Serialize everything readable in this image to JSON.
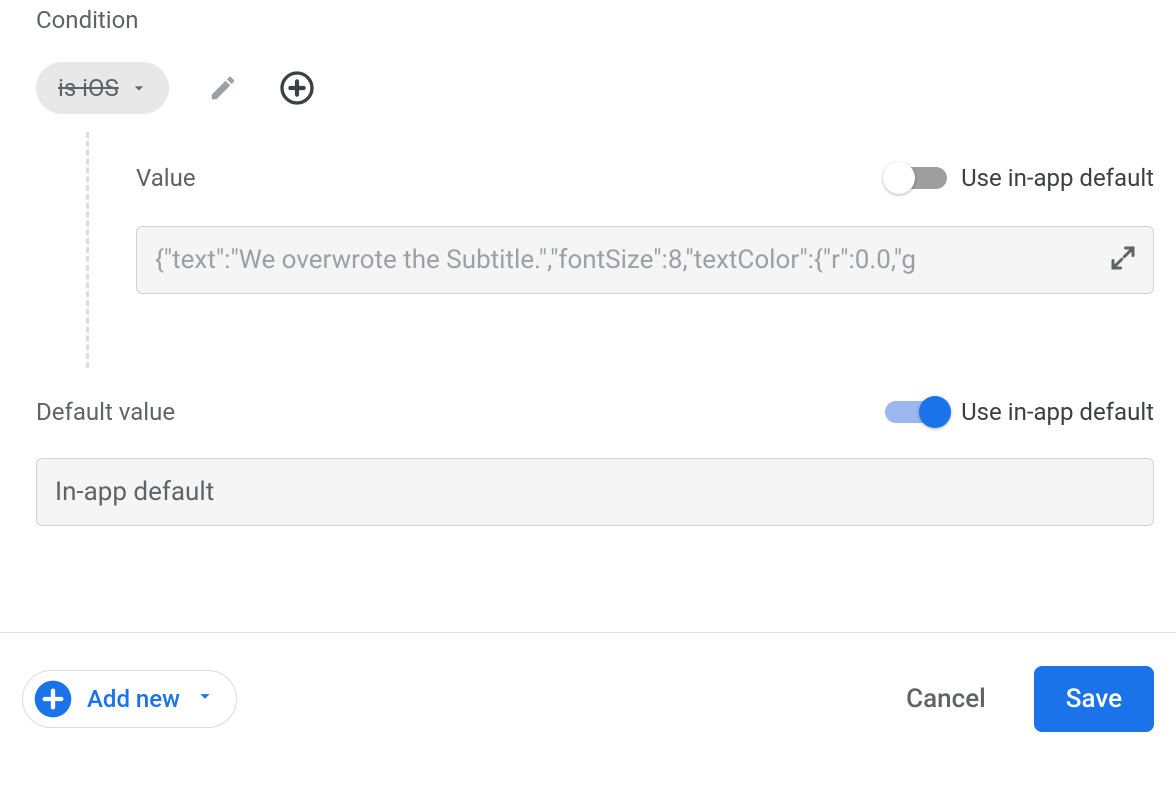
{
  "condition": {
    "label": "Condition",
    "chip_text": "is iOS"
  },
  "value": {
    "label": "Value",
    "use_default_label": "Use in-app default",
    "use_default_on": false,
    "input_text": "{\"text\":\"We overwrote the Subtitle.\",\"fontSize\":8,\"textColor\":{\"r\":0.0,\"g"
  },
  "default_value": {
    "label": "Default value",
    "use_default_label": "Use in-app default",
    "use_default_on": true,
    "input_text": "In-app default"
  },
  "footer": {
    "add_new_label": "Add new",
    "cancel_label": "Cancel",
    "save_label": "Save"
  }
}
